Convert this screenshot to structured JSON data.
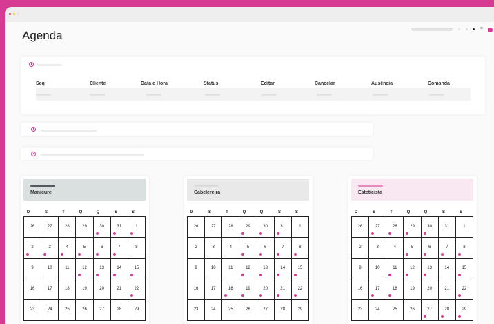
{
  "app": {
    "title": "Agenda"
  },
  "colors": {
    "brand": "#d63a92",
    "manicure": "#dadfe0",
    "cabeleireira": "#e9e9e9",
    "esteticista": "#f9e8f1"
  },
  "table": {
    "columns": [
      "Seq",
      "Cliente",
      "Data e Hora",
      "Status",
      "Editar",
      "Cancelar",
      "Ausência",
      "Comanda"
    ]
  },
  "weekdays": [
    "D",
    "S",
    "T",
    "Q",
    "Q",
    "S",
    "S"
  ],
  "calendars": [
    {
      "name": "Manicure",
      "weeks": [
        [
          {
            "d": "26"
          },
          {
            "d": "27"
          },
          {
            "d": "28"
          },
          {
            "d": "29"
          },
          {
            "d": "30",
            "dot": true
          },
          {
            "d": "31",
            "dot": true
          },
          {
            "d": "1",
            "dot": true
          }
        ],
        [
          {
            "d": "2",
            "dot": true
          },
          {
            "d": "3",
            "dot": true
          },
          {
            "d": "4",
            "dot": true
          },
          {
            "d": "5",
            "dot": true
          },
          {
            "d": "6",
            "dot": true
          },
          {
            "d": "7",
            "dot": true
          },
          {
            "d": "8"
          }
        ],
        [
          {
            "d": "9"
          },
          {
            "d": "10"
          },
          {
            "d": "11"
          },
          {
            "d": "12",
            "dot": true
          },
          {
            "d": "13",
            "dot": true
          },
          {
            "d": "14",
            "dot": true
          },
          {
            "d": "15",
            "dot": true
          }
        ],
        [
          {
            "d": "16"
          },
          {
            "d": "17"
          },
          {
            "d": "18"
          },
          {
            "d": "19"
          },
          {
            "d": "20"
          },
          {
            "d": "21"
          },
          {
            "d": "22",
            "dot": true
          }
        ],
        [
          {
            "d": "23"
          },
          {
            "d": "24"
          },
          {
            "d": "25"
          },
          {
            "d": "26"
          },
          {
            "d": "27"
          },
          {
            "d": "28"
          },
          {
            "d": "29"
          }
        ]
      ]
    },
    {
      "name": "Cabelereira",
      "weeks": [
        [
          {
            "d": "26"
          },
          {
            "d": "27"
          },
          {
            "d": "28"
          },
          {
            "d": "29",
            "dot": true
          },
          {
            "d": "30",
            "dot": true
          },
          {
            "d": "31",
            "dot": true
          },
          {
            "d": "1"
          }
        ],
        [
          {
            "d": "2"
          },
          {
            "d": "3"
          },
          {
            "d": "4"
          },
          {
            "d": "5",
            "dot": true
          },
          {
            "d": "6",
            "dot": true
          },
          {
            "d": "7",
            "dot": true
          },
          {
            "d": "8",
            "dot": true
          }
        ],
        [
          {
            "d": "9"
          },
          {
            "d": "10"
          },
          {
            "d": "11"
          },
          {
            "d": "12",
            "dot": true
          },
          {
            "d": "13",
            "dot": true
          },
          {
            "d": "14",
            "dot": true
          },
          {
            "d": "15",
            "dot": true
          }
        ],
        [
          {
            "d": "16"
          },
          {
            "d": "17"
          },
          {
            "d": "18",
            "dot": true
          },
          {
            "d": "19",
            "dot": true
          },
          {
            "d": "20",
            "dot": true
          },
          {
            "d": "21",
            "dot": true
          },
          {
            "d": "22",
            "dot": true
          }
        ],
        [
          {
            "d": "23"
          },
          {
            "d": "24"
          },
          {
            "d": "25"
          },
          {
            "d": "26"
          },
          {
            "d": "27"
          },
          {
            "d": "28"
          },
          {
            "d": "29"
          }
        ]
      ]
    },
    {
      "name": "Esteticista",
      "weeks": [
        [
          {
            "d": "26"
          },
          {
            "d": "27",
            "dot": true
          },
          {
            "d": "28",
            "dot": true
          },
          {
            "d": "29",
            "dot": true
          },
          {
            "d": "30",
            "dot": true
          },
          {
            "d": "31"
          },
          {
            "d": "1"
          }
        ],
        [
          {
            "d": "2"
          },
          {
            "d": "3"
          },
          {
            "d": "4"
          },
          {
            "d": "5",
            "dot": true
          },
          {
            "d": "6",
            "dot": true
          },
          {
            "d": "7",
            "dot": true
          },
          {
            "d": "8",
            "dot": true
          }
        ],
        [
          {
            "d": "9"
          },
          {
            "d": "10"
          },
          {
            "d": "11",
            "dot": true
          },
          {
            "d": "12",
            "dot": true
          },
          {
            "d": "13",
            "dot": true
          },
          {
            "d": "14"
          },
          {
            "d": "15",
            "dot": true
          }
        ],
        [
          {
            "d": "16"
          },
          {
            "d": "17",
            "dot": true
          },
          {
            "d": "18",
            "dot": true
          },
          {
            "d": "19"
          },
          {
            "d": "20"
          },
          {
            "d": "21"
          },
          {
            "d": "22",
            "dot": true
          }
        ],
        [
          {
            "d": "23"
          },
          {
            "d": "24"
          },
          {
            "d": "25"
          },
          {
            "d": "26"
          },
          {
            "d": "27",
            "dot": true
          },
          {
            "d": "28",
            "dot": true
          },
          {
            "d": "29",
            "dot": true
          }
        ]
      ]
    }
  ]
}
